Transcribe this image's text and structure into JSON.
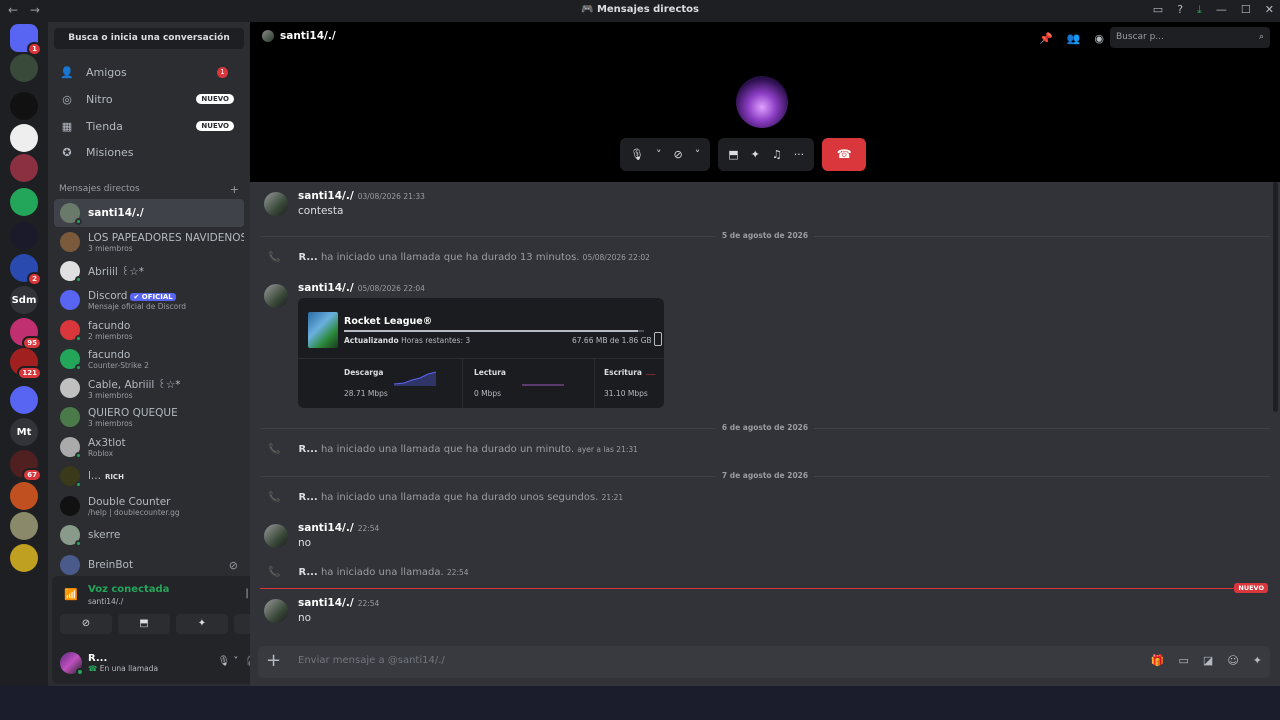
{
  "window": {
    "title": "Mensajes directos",
    "nav_back": "←",
    "nav_forward": "→"
  },
  "servers": [
    {
      "label": "",
      "badge": "1",
      "color": "#5865f2",
      "icon": "discord-logo-icon"
    },
    {
      "label": "",
      "badge": "",
      "color": "#3a4a3a",
      "icon": "avatar-icon"
    },
    {
      "label": "",
      "badge": "",
      "color": "#111",
      "icon": "rlr-logo-icon"
    },
    {
      "label": "",
      "badge": "",
      "color": "#eee",
      "icon": "server-logo-icon"
    },
    {
      "label": "",
      "badge": "",
      "color": "#8a3040",
      "icon": "server-logo-icon"
    },
    {
      "label": "",
      "badge": "",
      "color": "#23a55a",
      "icon": "k-logo-icon"
    },
    {
      "label": "",
      "badge": "",
      "color": "#1a1a2a",
      "icon": "server-logo-icon"
    },
    {
      "label": "",
      "badge": "2",
      "color": "#2a4ab0",
      "icon": "server-logo-icon"
    },
    {
      "label": "Sdm",
      "badge": "",
      "color": "#313338",
      "icon": ""
    },
    {
      "label": "",
      "badge": "95",
      "color": "#c03070",
      "icon": "server-logo-icon"
    },
    {
      "label": "",
      "badge": "121",
      "color": "#a02020",
      "icon": "server-logo-icon"
    },
    {
      "label": "",
      "badge": "",
      "color": "#5865f2",
      "icon": "k-logo-icon"
    },
    {
      "label": "Mt",
      "badge": "",
      "color": "#313338",
      "icon": ""
    },
    {
      "label": "",
      "badge": "67",
      "color": "#502020",
      "icon": "server-logo-icon"
    },
    {
      "label": "",
      "badge": "",
      "color": "#c05020",
      "icon": "server-logo-icon"
    },
    {
      "label": "",
      "badge": "",
      "color": "#8a8a6a",
      "icon": "server-logo-icon"
    },
    {
      "label": "",
      "badge": "",
      "color": "#c0a020",
      "icon": "server-logo-icon"
    }
  ],
  "sidebar": {
    "search_label": "Busca o inicia una conversación",
    "nav": [
      {
        "label": "Amigos",
        "icon": "friends-icon",
        "badge": "1",
        "tag": ""
      },
      {
        "label": "Nitro",
        "icon": "nitro-icon",
        "badge": "",
        "tag": "NUEVO"
      },
      {
        "label": "Tienda",
        "icon": "shop-icon",
        "badge": "",
        "tag": "NUEVO"
      },
      {
        "label": "Misiones",
        "icon": "quests-icon",
        "badge": "",
        "tag": ""
      }
    ],
    "dm_header": "Mensajes directos",
    "dm_add": "+",
    "dms": [
      {
        "name": "santi14/./",
        "sub": "",
        "color": "#6a7a6a"
      },
      {
        "name": "LOS PAPEADORES NAVIDEÑOS",
        "sub": "3 miembros",
        "color": "#7a5a3a"
      },
      {
        "name": "Abriiil ꒰☆*",
        "sub": "",
        "color": "#e0e0e0"
      },
      {
        "name": "Discord",
        "sub": "Mensaje oficial de Discord",
        "color": "#5865f2"
      },
      {
        "name": "facundo",
        "sub": "2 miembros",
        "color": "#da373c"
      },
      {
        "name": "facundo",
        "sub": "Counter-Strike 2",
        "color": "#23a55a"
      },
      {
        "name": "Cable, Abriiil ꒰☆*",
        "sub": "3 miembros",
        "color": "#c0c0c0"
      },
      {
        "name": "QUIERO QUEQUE",
        "sub": "3 miembros",
        "color": "#4a7a4a"
      },
      {
        "name": "Ax3tlot",
        "sub": "Roblox",
        "color": "#aaa"
      },
      {
        "name": "l...",
        "sub": "",
        "color": "#3a3a1a"
      },
      {
        "name": "Double Counter",
        "sub": "/help | doublecounter.gg",
        "color": "#111"
      },
      {
        "name": "skerre",
        "sub": "",
        "color": "#8a9a8a"
      },
      {
        "name": "BreinBot",
        "sub": "",
        "color": "#4a5a8a"
      }
    ],
    "official_tag": "✔ OFICIAL",
    "rich_tag": "RICH",
    "voice": {
      "title": "Voz conectada",
      "channel": "santi14/./",
      "buttons": [
        "camera-off",
        "screen-share",
        "activities",
        "soundboard"
      ]
    },
    "user": {
      "name": "R...",
      "status": "En una llamada"
    }
  },
  "header": {
    "channel_name": "santi14/./",
    "search_placeholder": "Buscar p..."
  },
  "messages": {
    "m1": {
      "author": "santi14/./",
      "time": "03/08/2026 21:33",
      "text": "contesta"
    },
    "d1": "5 de agosto de 2026",
    "s1": {
      "user": "R...",
      "text": "ha iniciado una llamada que ha durado 13 minutos.",
      "time": "05/08/2026 22:02"
    },
    "m2": {
      "author": "santi14/./",
      "time": "05/08/2026 22:04"
    },
    "d2": "6 de agosto de 2026",
    "s2": {
      "user": "R...",
      "text": "ha iniciado una llamada que ha durado un minuto.",
      "time": "ayer a las 21:31"
    },
    "d3": "7 de agosto de 2026",
    "s3": {
      "user": "R...",
      "text": "ha iniciado una llamada que ha durado unos segundos.",
      "time": "21:21"
    },
    "m3": {
      "author": "santi14/./",
      "time": "22:54",
      "text": "no"
    },
    "s4": {
      "user": "R...",
      "text": "ha iniciado una llamada.",
      "time": "22:54"
    },
    "new_tag": "NUEVO",
    "m4": {
      "author": "santi14/./",
      "time": "22:54",
      "text": "no"
    }
  },
  "embed": {
    "game": "Rocket League®",
    "status": "Actualizando",
    "remaining": "Horas restantes: 3",
    "size": "67.66 MB de 1.86 GB",
    "progress": 0.98,
    "stats": [
      {
        "label": "Descarga",
        "value": "28.71 Mbps",
        "color": "#5865f2"
      },
      {
        "label": "Lectura",
        "value": "0 Mbps",
        "color": "#9b59b6"
      },
      {
        "label": "Escritura",
        "value": "31.10 Mbps",
        "color": "#da373c"
      }
    ]
  },
  "compose": {
    "placeholder": "Enviar mensaje a @santi14/./"
  }
}
